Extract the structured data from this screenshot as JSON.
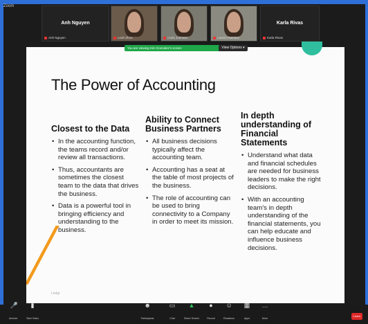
{
  "app": {
    "badge": "Zoom"
  },
  "participants": [
    {
      "name": "Anh Nguyen",
      "label": "Anh Nguyen",
      "video": false
    },
    {
      "name": "",
      "label": "Leah Zhou",
      "video": true
    },
    {
      "name": "",
      "label": "Carla Johnson",
      "video": true
    },
    {
      "name": "",
      "label": "Lauren Ramirez",
      "video": true
    },
    {
      "name": "Karla Rivas",
      "label": "Karla Rivas",
      "video": false
    }
  ],
  "share_bar": {
    "text": "You are viewing Kim Gonzalez's screen",
    "view_options": "View Options ▾"
  },
  "slide": {
    "title": "The Power of Accounting",
    "columns": [
      {
        "heading": "Closest to the Data",
        "bullets": [
          "In the accounting function, the teams record and/or review all transactions.",
          "Thus, accountants are sometimes the closest team to the data that drives the business.",
          "Data is a powerful tool in bringing efficiency and understanding to the business."
        ]
      },
      {
        "heading": "Ability to Connect Business Partners",
        "bullets": [
          "All business decisions typically affect the accounting team.",
          "Accounting has a seat at the table of most projects of the business.",
          "The role of accounting can be used to bring connectivity to a Company in order to meet its mission."
        ]
      },
      {
        "heading": "In depth understanding of Financial Statements",
        "bullets": [
          "Understand what data and financial schedules are needed for business leaders to make the right decisions.",
          "With an accounting team's in depth understanding of the financial statements, you can help educate and influence business decisions."
        ]
      }
    ],
    "footer": "Ledgr"
  },
  "toolbar": {
    "items": [
      {
        "label": "Unmute",
        "icon": "mic-icon"
      },
      {
        "label": "Start Video",
        "icon": "video-icon"
      },
      {
        "label": "Participants",
        "icon": "participants-icon"
      },
      {
        "label": "Chat",
        "icon": "chat-icon"
      },
      {
        "label": "Share Screen",
        "icon": "share-icon"
      },
      {
        "label": "Record",
        "icon": "record-icon"
      },
      {
        "label": "Reactions",
        "icon": "reactions-icon"
      },
      {
        "label": "Apps",
        "icon": "apps-icon"
      },
      {
        "label": "More",
        "icon": "more-icon"
      }
    ],
    "leave_label": "Leave"
  },
  "colors": {
    "frame": "#2f6fd8",
    "share": "#1ea648",
    "accent": "#f39a1c",
    "teal": "#2fbf9f",
    "leave": "#e02828"
  }
}
